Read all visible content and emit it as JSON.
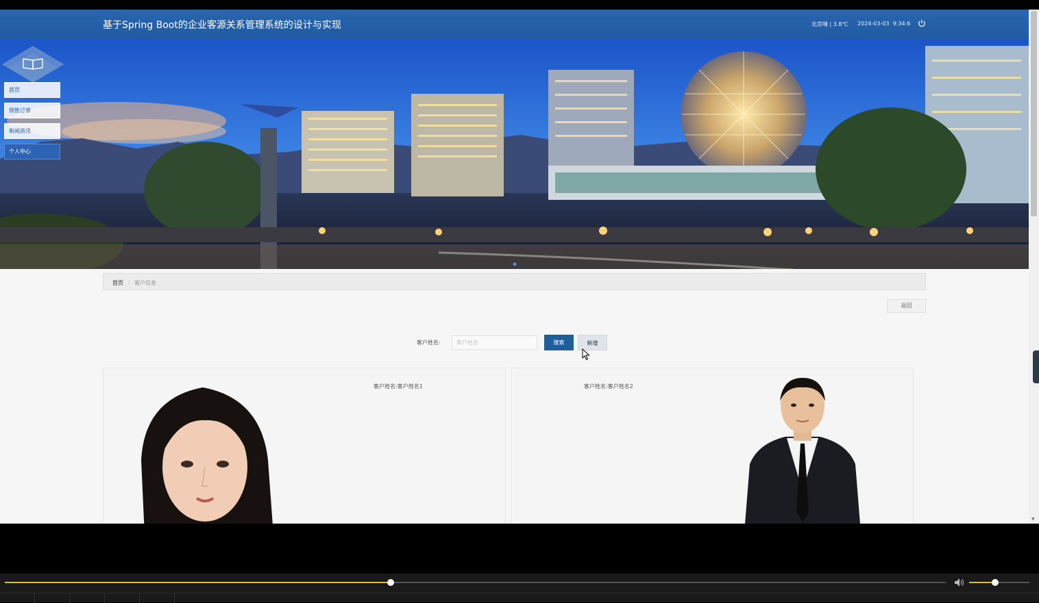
{
  "header": {
    "title": "基于Spring Boot的企业客源关系管理系统的设计与实现",
    "weather": "北京晴 | 3.8℃",
    "date": "2024-03-03",
    "time": "9:34:6"
  },
  "nav": {
    "items": [
      {
        "label": "首页"
      },
      {
        "label": "销售订单"
      },
      {
        "label": "新闻资讯"
      },
      {
        "label": "个人中心"
      }
    ]
  },
  "breadcrumb": {
    "home": "首页",
    "separator": "/",
    "current": "客户信息"
  },
  "actions": {
    "back": "返回"
  },
  "search": {
    "label": "客户姓名:",
    "placeholder": "客户姓名",
    "value": "",
    "search_button": "搜索",
    "add_button": "新增"
  },
  "cards": [
    {
      "name_label": "客户姓名:",
      "name": "客户姓名1"
    },
    {
      "name_label": "客户姓名:",
      "name": "客户姓名2"
    }
  ],
  "player": {
    "progress": 0.41,
    "volume": 0.43
  },
  "colors": {
    "header_bg": "#2162aa",
    "search_button": "#1f5e97",
    "progress": "#e2bf2d"
  },
  "icons": {
    "power": "power-icon",
    "logo": "open-book-icon",
    "volume": "speaker-icon"
  }
}
